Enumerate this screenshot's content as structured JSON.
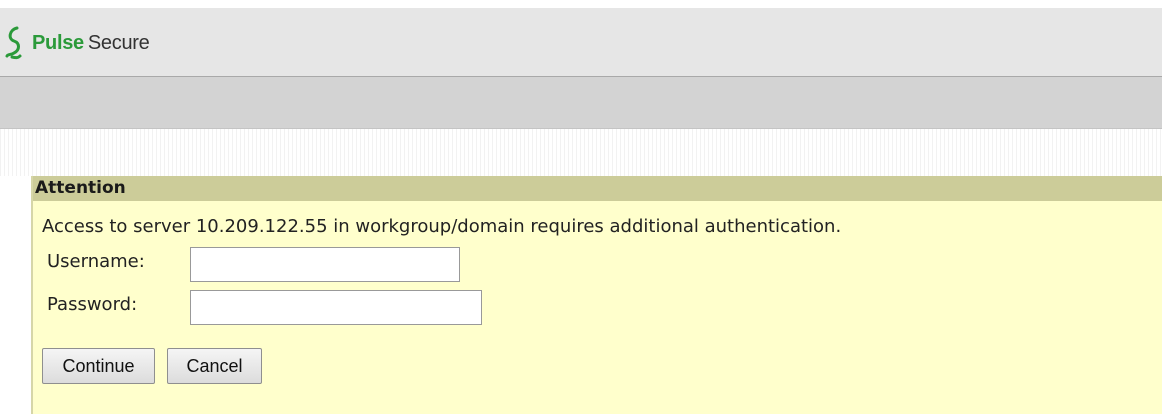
{
  "header": {
    "brand_primary": "Pulse",
    "brand_secondary": "Secure",
    "logo_icon": "pulse-secure-logo-icon"
  },
  "panel": {
    "title": "Attention",
    "message": "Access to server 10.209.122.55 in workgroup/domain requires additional authentication.",
    "username_label": "Username:",
    "password_label": "Password:",
    "username_value": "",
    "password_value": "",
    "continue_label": "Continue",
    "cancel_label": "Cancel"
  },
  "colors": {
    "header_bg": "#e6e6e6",
    "navbar_bg": "#d3d3d3",
    "panel_bg": "#ffffcc",
    "panel_title_bg": "#cccc99",
    "brand_green": "#2b9a3a"
  }
}
